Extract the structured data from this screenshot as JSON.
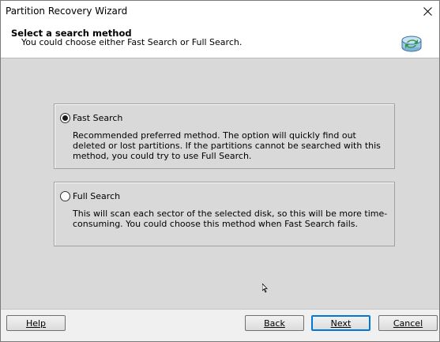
{
  "window": {
    "title": "Partition Recovery Wizard"
  },
  "header": {
    "title": "Select a search method",
    "subtitle": "You could choose either Fast Search or Full Search."
  },
  "options": [
    {
      "label": "Fast Search",
      "selected": true,
      "description": "Recommended preferred method. The option will quickly find out deleted or lost partitions. If the partitions cannot be searched with this method, you could try to use Full Search."
    },
    {
      "label": "Full Search",
      "selected": false,
      "description": "This will scan each sector of the selected disk, so this will be more time-consuming. You could choose this method when Fast Search fails."
    }
  ],
  "buttons": {
    "help": "Help",
    "back": "Back",
    "next": "Next",
    "cancel": "Cancel"
  },
  "icons": {
    "header": "partition-recovery-icon",
    "close": "close-icon"
  },
  "colors": {
    "content_bg": "#d9d9d9",
    "accent": "#0078d7"
  }
}
